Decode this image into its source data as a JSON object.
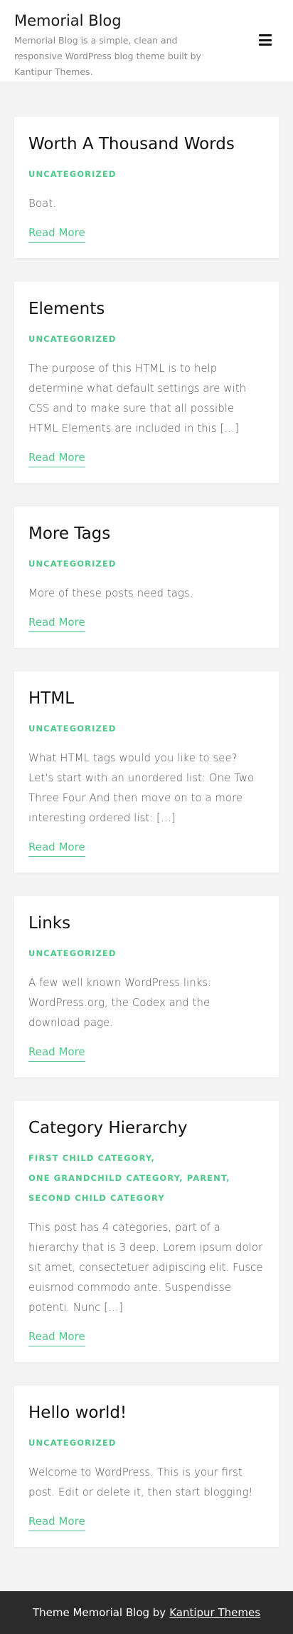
{
  "header": {
    "title": "Memorial Blog",
    "description": "Memorial Blog is a simple, clean and responsive WordPress blog theme built by Kantipur Themes.",
    "menu_icon": "hamburger-menu-icon"
  },
  "posts": [
    {
      "title": "Worth A Thousand Words",
      "categories": [
        "UNCATEGORIZED"
      ],
      "excerpt": "Boat.",
      "read_more": "Read More"
    },
    {
      "title": "Elements",
      "categories": [
        "UNCATEGORIZED"
      ],
      "excerpt": "The purpose of this HTML is to help determine what default settings are with CSS and to make sure that all possible HTML Elements are included in this […]",
      "read_more": "Read More"
    },
    {
      "title": "More Tags",
      "categories": [
        "UNCATEGORIZED"
      ],
      "excerpt": "More of these posts need tags.",
      "read_more": "Read More"
    },
    {
      "title": "HTML",
      "categories": [
        "UNCATEGORIZED"
      ],
      "excerpt": "What HTML tags would you like to see? Let's start with an unordered list: One Two Three Four And then move on to a more interesting ordered list: […]",
      "read_more": "Read More"
    },
    {
      "title": "Links",
      "categories": [
        "UNCATEGORIZED"
      ],
      "excerpt": "A few well known WordPress links: WordPress.org, the Codex and the download page.",
      "read_more": "Read More"
    },
    {
      "title": "Category Hierarchy",
      "categories": [
        "FIRST CHILD CATEGORY,",
        "ONE GRANDCHILD CATEGORY,",
        "PARENT,",
        "SECOND CHILD CATEGORY"
      ],
      "excerpt": "This post has 4 categories, part of a hierarchy that is 3 deep. Lorem ipsum dolor sit amet, consectetuer adipiscing elit. Fusce euismod commodo ante. Suspendisse potenti. Nunc […]",
      "read_more": "Read More"
    },
    {
      "title": "Hello world!",
      "categories": [
        "UNCATEGORIZED"
      ],
      "excerpt": "Welcome to WordPress. This is your first post. Edit or delete it, then start blogging!",
      "read_more": "Read More"
    }
  ],
  "footer": {
    "prefix": "Theme Memorial Blog by",
    "link_text": "Kantipur Themes"
  },
  "colors": {
    "accent": "#4ec98a",
    "footer_bg": "#2b2b2b",
    "page_bg": "#f3f3f3"
  }
}
